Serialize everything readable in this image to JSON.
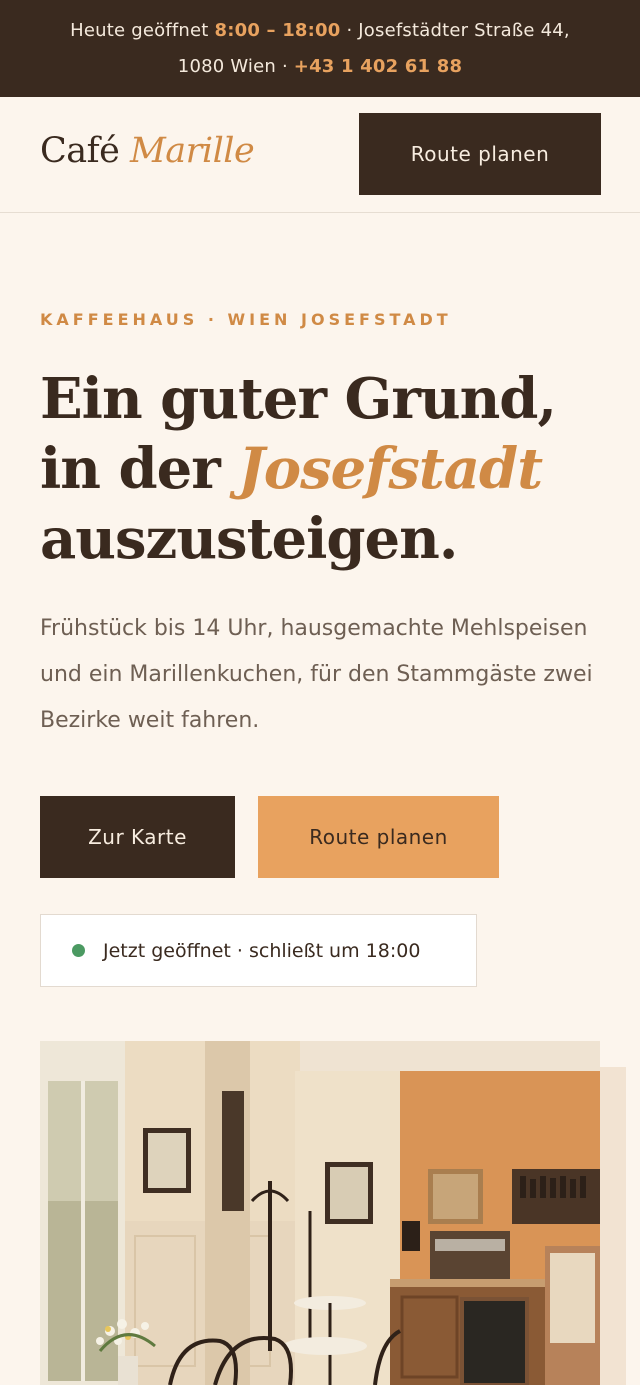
{
  "topbar": {
    "open_label": "Heute geöffnet",
    "hours": "8:00 – 18:00",
    "sep1": "·",
    "address": "Josefstädter Straße 44, 1080 Wien",
    "sep2": "·",
    "phone": "+43 1 402 61 88"
  },
  "header": {
    "logo_main": "Café",
    "logo_accent": "Marille",
    "route_button": "Route planen"
  },
  "hero": {
    "eyebrow": "KAFFEEHAUS · WIEN JOSEFSTADT",
    "headline_part1": "Ein guter Grund, in der",
    "headline_accent": "Josefstadt",
    "headline_part2": "auszusteigen.",
    "lede": "Frühstück bis 14 Uhr, hausgemachte Mehlspeisen und ein Marillenkuchen, für den Stammgäste zwei Bezirke weit fahren.",
    "menu_button": "Zur Karte",
    "route_button": "Route planen",
    "status_text": "Jetzt geöffnet · schließt um 18:00"
  },
  "colors": {
    "brand_dark": "#3a2a1f",
    "accent": "#d08a45",
    "accent_button": "#e8a25f",
    "status_open": "#4b9a62"
  }
}
